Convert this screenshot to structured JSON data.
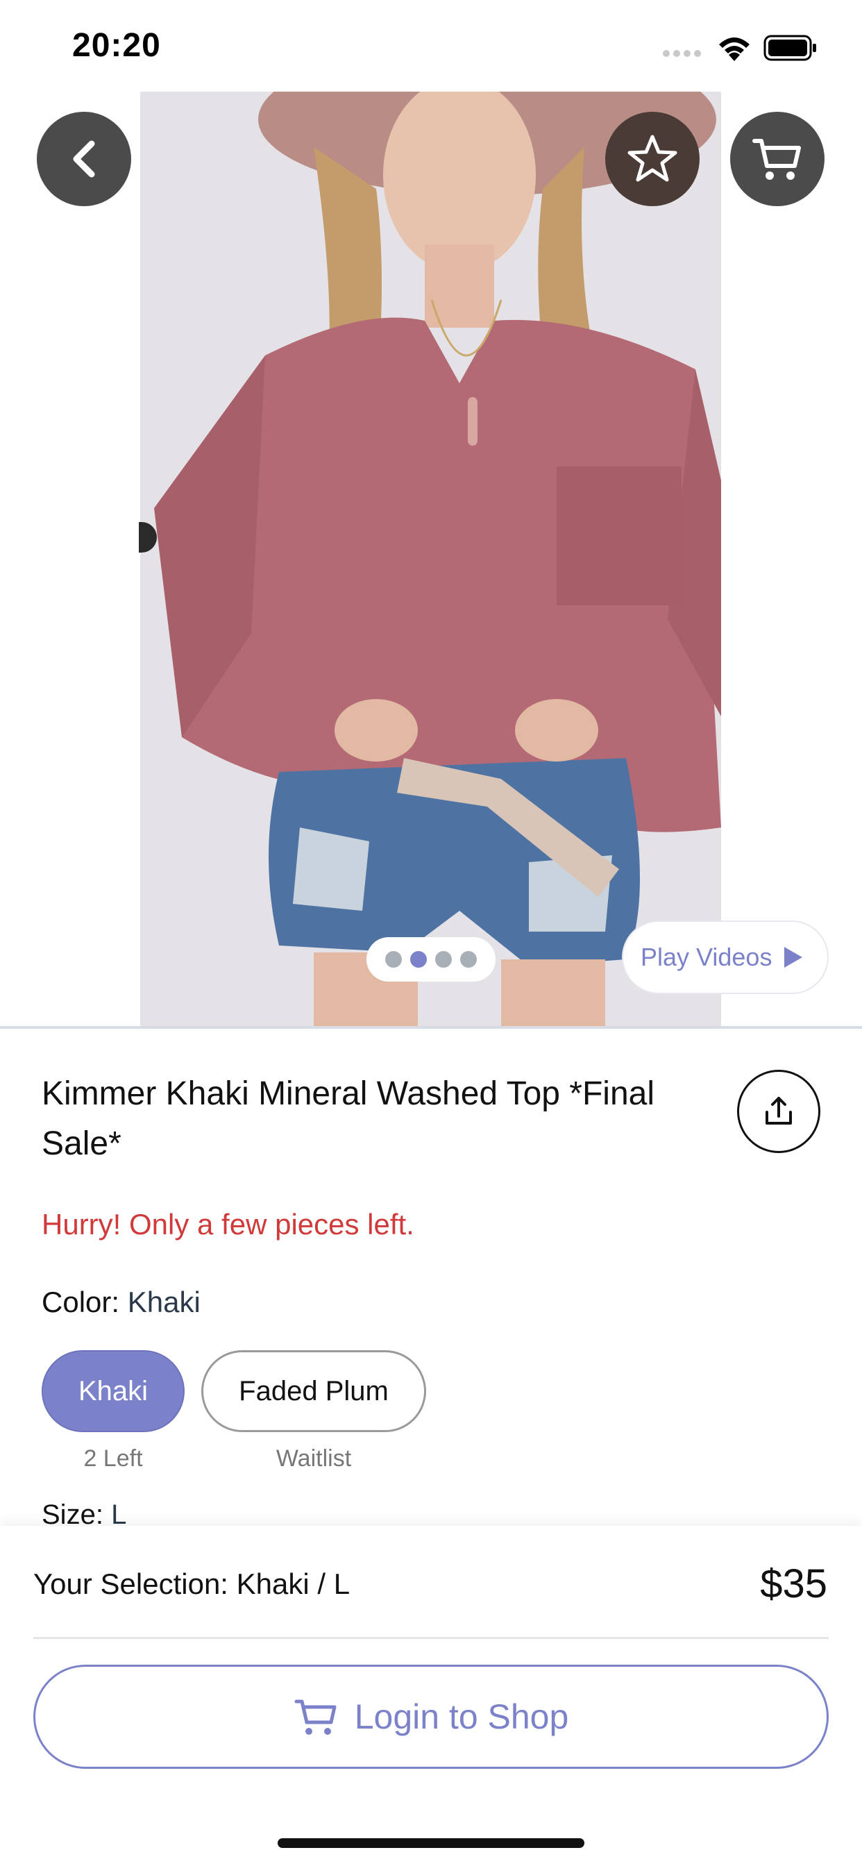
{
  "status_bar": {
    "time": "20:20"
  },
  "gallery": {
    "play_videos_label": "Play Videos",
    "page_count": 4,
    "active_page": 2
  },
  "product": {
    "title": "Kimmer Khaki Mineral Washed Top *Final Sale*",
    "stock_message": "Hurry! Only a few pieces left.",
    "color_label": "Color:",
    "color_value": "Khaki",
    "color_options": [
      {
        "label": "Khaki",
        "sub": "2 Left",
        "selected": true
      },
      {
        "label": "Faded Plum",
        "sub": "Waitlist",
        "selected": false
      }
    ],
    "size_label": "Size:",
    "size_value": "L"
  },
  "bottom_bar": {
    "selection_label": "Your Selection: Khaki / L",
    "price": "$35",
    "login_label": "Login to Shop"
  },
  "colors": {
    "accent": "#7b82c9",
    "alert": "#d03a3a"
  }
}
